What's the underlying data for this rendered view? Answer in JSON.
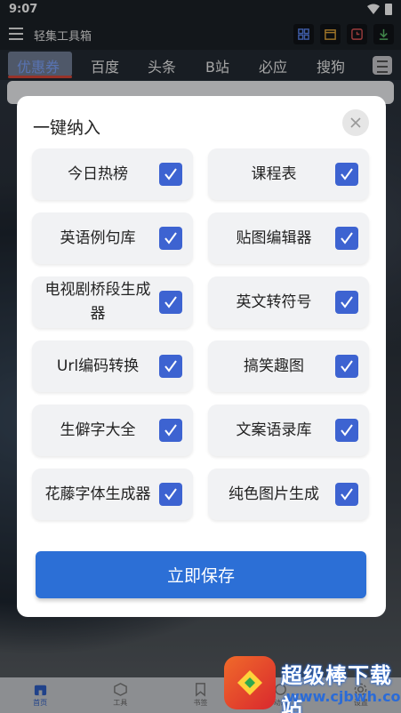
{
  "status_bar": {
    "time": "9:07"
  },
  "app": {
    "title": "轻集工具箱"
  },
  "tabs": [
    {
      "label": "优惠券"
    },
    {
      "label": "百度"
    },
    {
      "label": "头条"
    },
    {
      "label": "B站"
    },
    {
      "label": "必应"
    },
    {
      "label": "搜狗"
    }
  ],
  "header_icons": [
    "grid-icon",
    "calendar-icon",
    "clock-icon",
    "download-icon"
  ],
  "dialog": {
    "title": "一键纳入",
    "items": [
      {
        "label": "今日热榜",
        "checked": true
      },
      {
        "label": "课程表",
        "checked": true
      },
      {
        "label": "英语例句库",
        "checked": true
      },
      {
        "label": "贴图编辑器",
        "checked": true
      },
      {
        "label": "电视剧桥段生成器",
        "checked": true
      },
      {
        "label": "英文转符号",
        "checked": true
      },
      {
        "label": "Url编码转换",
        "checked": true
      },
      {
        "label": "搞笑趣图",
        "checked": true
      },
      {
        "label": "生僻字大全",
        "checked": true
      },
      {
        "label": "文案语录库",
        "checked": true
      },
      {
        "label": "花藤字体生成器",
        "checked": true
      },
      {
        "label": "纯色图片生成",
        "checked": true
      }
    ],
    "save_label": "立即保存"
  },
  "bottom_nav": [
    {
      "label": "首页",
      "icon": "home-icon",
      "active": true
    },
    {
      "label": "工具",
      "icon": "cube-icon",
      "active": false
    },
    {
      "label": "书签",
      "icon": "bookmark-icon",
      "active": false
    },
    {
      "label": "动态",
      "icon": "feed-icon",
      "active": false
    },
    {
      "label": "设置",
      "icon": "settings-icon",
      "active": false
    }
  ],
  "watermark": {
    "title": "超级棒下载站",
    "url": "www.cjbwh.com"
  },
  "colors": {
    "accent": "#3d63d1",
    "save_button": "#2c6fd6",
    "tab_active": "#7fa5ff",
    "tab_underline": "#d9483a"
  }
}
